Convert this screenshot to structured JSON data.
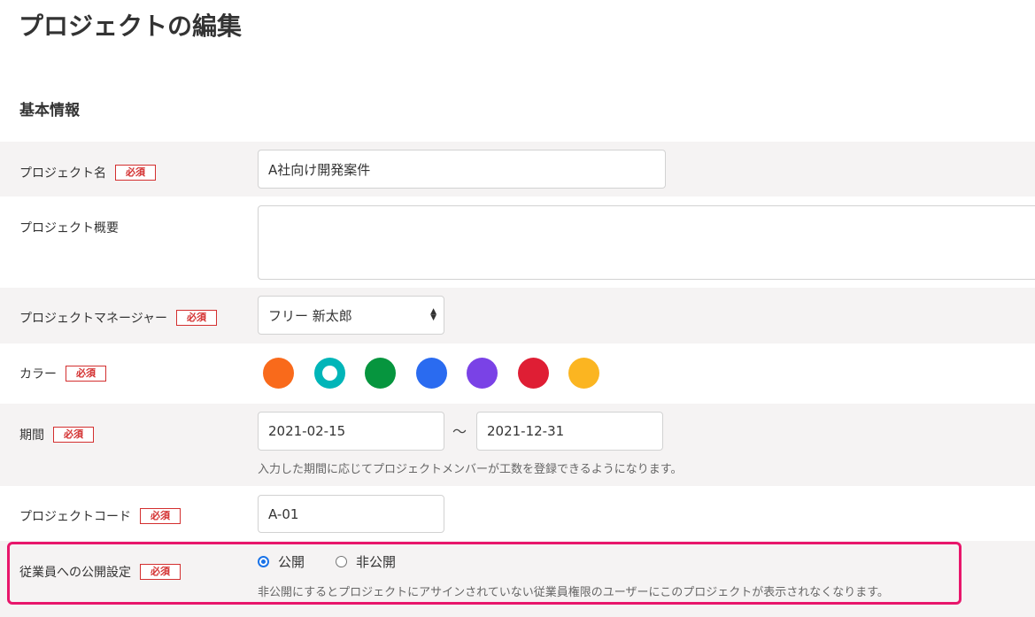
{
  "page_title": "プロジェクトの編集",
  "section_title": "基本情報",
  "required_badge": "必須",
  "colors": {
    "accent_highlight": "#e8166b",
    "required": "#d32f2f",
    "radio": "#1a73e8"
  },
  "fields": {
    "name": {
      "label": "プロジェクト名",
      "value": "A社向け開発案件"
    },
    "summary": {
      "label": "プロジェクト概要",
      "value": ""
    },
    "manager": {
      "label": "プロジェクトマネージャー",
      "value": "フリー 新太郎"
    },
    "color": {
      "label": "カラー",
      "swatches": [
        {
          "name": "orange",
          "hex": "#f96a1b",
          "selected": false
        },
        {
          "name": "teal",
          "hex": "#00b5b8",
          "selected": true
        },
        {
          "name": "green",
          "hex": "#06953e",
          "selected": false
        },
        {
          "name": "blue",
          "hex": "#2a6bf0",
          "selected": false
        },
        {
          "name": "purple",
          "hex": "#7a42e6",
          "selected": false
        },
        {
          "name": "red",
          "hex": "#df1e34",
          "selected": false
        },
        {
          "name": "yellow",
          "hex": "#fbb521",
          "selected": false
        }
      ]
    },
    "period": {
      "label": "期間",
      "start": "2021-02-15",
      "separator": "〜",
      "end": "2021-12-31",
      "help": "入力した期間に応じてプロジェクトメンバーが工数を登録できるようになります。"
    },
    "code": {
      "label": "プロジェクトコード",
      "value": "A-01"
    },
    "visibility": {
      "label": "従業員への公開設定",
      "options": [
        {
          "label": "公開",
          "checked": true
        },
        {
          "label": "非公開",
          "checked": false
        }
      ],
      "help": "非公開にするとプロジェクトにアサインされていない従業員権限のユーザーにこのプロジェクトが表示されなくなります。"
    }
  }
}
